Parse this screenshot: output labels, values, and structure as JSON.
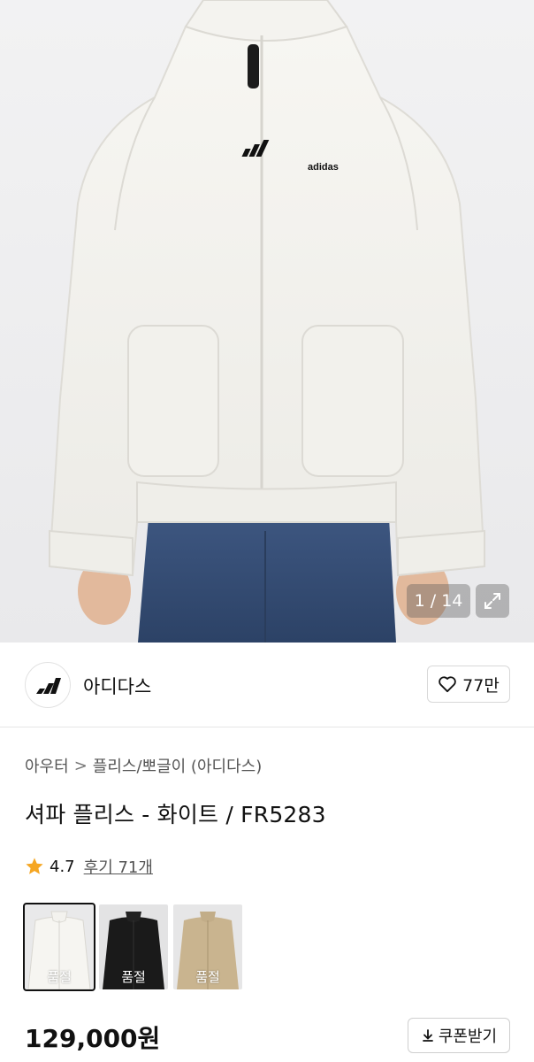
{
  "hero": {
    "image_counter": "1 / 14",
    "product_logo_text": "adidas"
  },
  "brand": {
    "name": "아디다스",
    "likes": "77만"
  },
  "breadcrumb": {
    "category": "아우터",
    "separator": ">",
    "subcategory": "플리스/뽀글이 (아디다스)"
  },
  "product": {
    "title": "셔파 플리스 - 화이트 / FR5283",
    "rating": "4.7",
    "reviews": "후기 71개",
    "price": "129,000원",
    "coupon_label": "쿠폰받기"
  },
  "variants": [
    {
      "status": "품절",
      "color": "#eeece6"
    },
    {
      "status": "품절",
      "color": "#1a1a1a"
    },
    {
      "status": "품절",
      "color": "#c9b48f"
    }
  ],
  "colors": {
    "star": "#f5a623",
    "text": "#111111",
    "muted": "#555555"
  }
}
